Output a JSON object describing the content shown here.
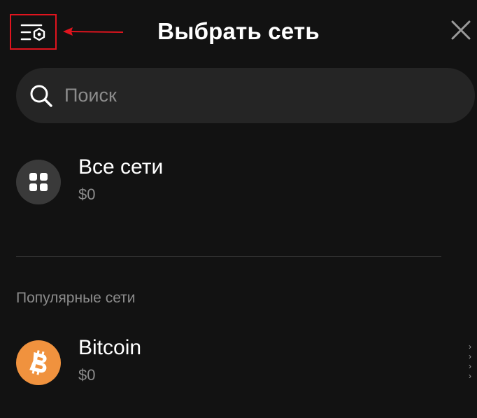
{
  "header": {
    "title": "Выбрать сеть",
    "manage_icon": "manage-networks-icon",
    "close_icon": "close-icon",
    "highlight_color": "#e0141e"
  },
  "search": {
    "placeholder": "Поиск",
    "value": "",
    "icon": "search-icon"
  },
  "all_networks": {
    "name": "Все сети",
    "balance": "$0",
    "icon": "grid-icon"
  },
  "popular": {
    "label": "Популярные сети",
    "items": [
      {
        "name": "Bitcoin",
        "balance": "$0",
        "icon": "bitcoin-icon",
        "color": "#f0923e"
      }
    ]
  },
  "colors": {
    "background": "#121212",
    "surface": "#252525",
    "muted_text": "#8c8c8c"
  }
}
